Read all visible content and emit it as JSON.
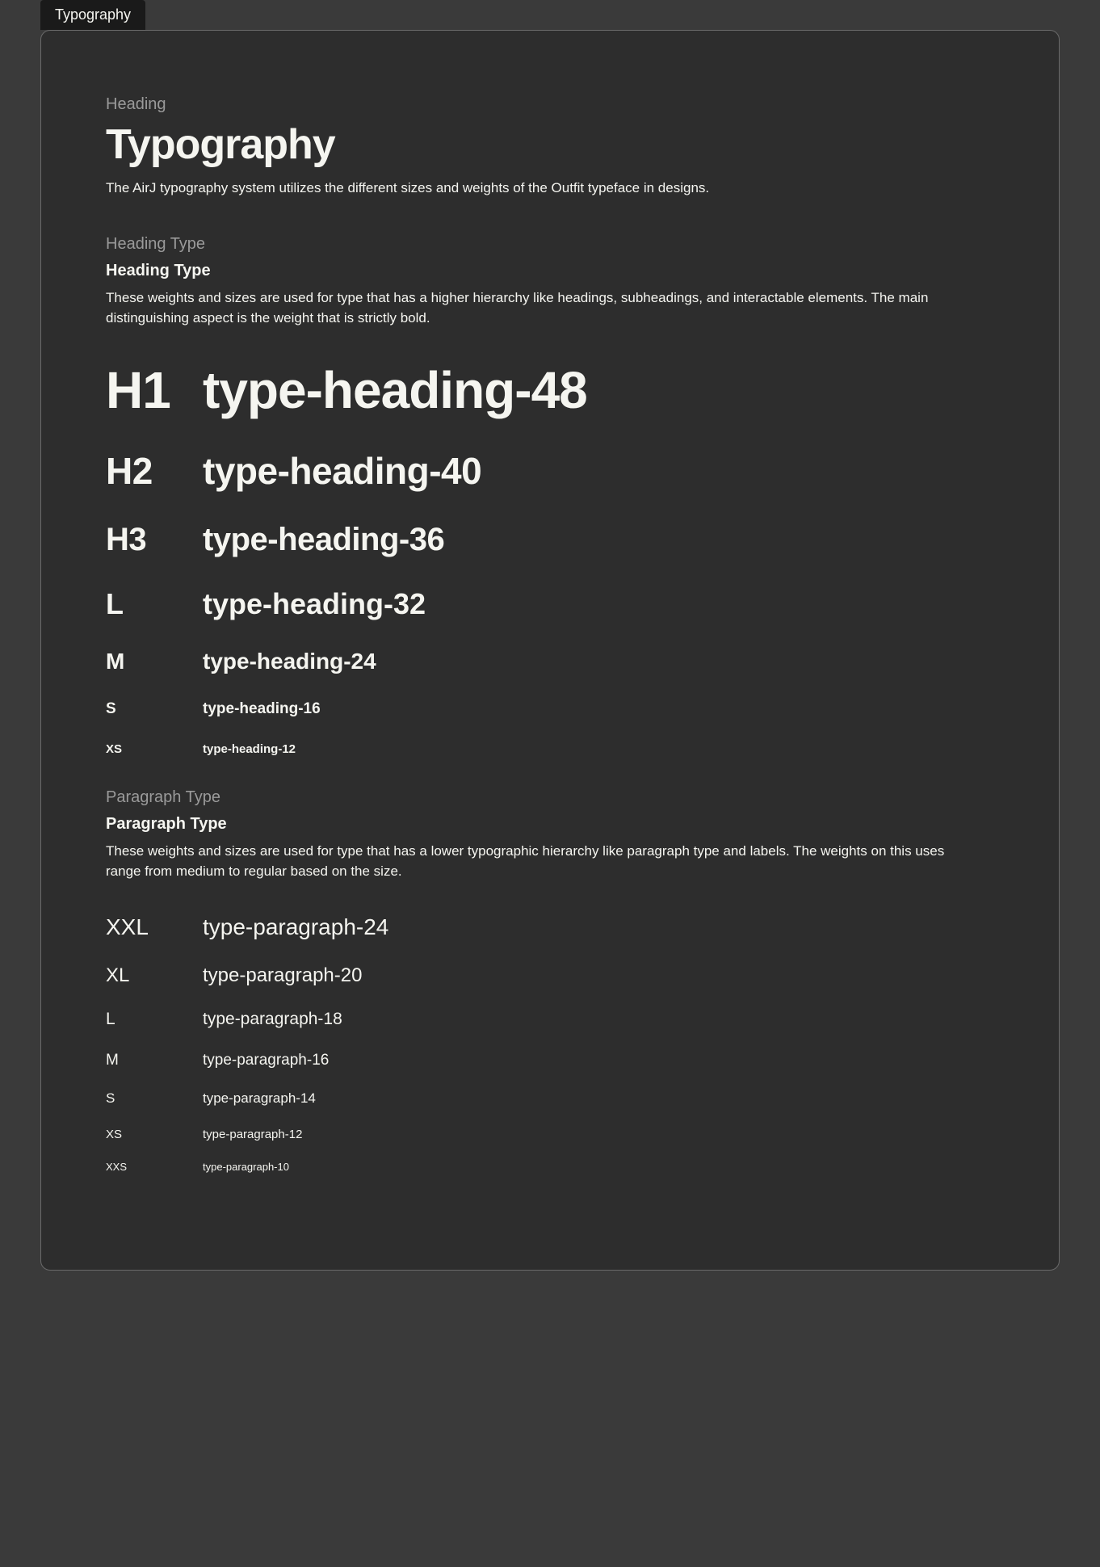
{
  "tab": {
    "label": "Typography"
  },
  "heading": {
    "label": "Heading",
    "title": "Typography",
    "intro": "The AirJ typography system utilizes the different sizes and weights of the Outfit typeface in designs."
  },
  "heading_type": {
    "label": "Heading Type",
    "title": "Heading Type",
    "desc": "These weights and sizes are used for type that has a higher hierarchy like headings, subheadings, and interactable elements. The main distinguishing aspect is the weight that is strictly bold.",
    "rows": [
      {
        "code": "H1",
        "name": "type-heading-48"
      },
      {
        "code": "H2",
        "name": "type-heading-40"
      },
      {
        "code": "H3",
        "name": "type-heading-36"
      },
      {
        "code": "L",
        "name": "type-heading-32"
      },
      {
        "code": "M",
        "name": "type-heading-24"
      },
      {
        "code": "S",
        "name": "type-heading-16"
      },
      {
        "code": "XS",
        "name": "type-heading-12"
      }
    ]
  },
  "paragraph_type": {
    "label": "Paragraph Type",
    "title": "Paragraph Type",
    "desc": "These weights and sizes are used for type that has a lower typographic hierarchy like paragraph type and labels. The weights on this uses range from medium to regular based on the size.",
    "rows": [
      {
        "code": "XXL",
        "name": "type-paragraph-24"
      },
      {
        "code": "XL",
        "name": "type-paragraph-20"
      },
      {
        "code": "L",
        "name": "type-paragraph-18"
      },
      {
        "code": "M",
        "name": "type-paragraph-16"
      },
      {
        "code": "S",
        "name": "type-paragraph-14"
      },
      {
        "code": "XS",
        "name": "type-paragraph-12"
      },
      {
        "code": "XXS",
        "name": "type-paragraph-10"
      }
    ]
  }
}
